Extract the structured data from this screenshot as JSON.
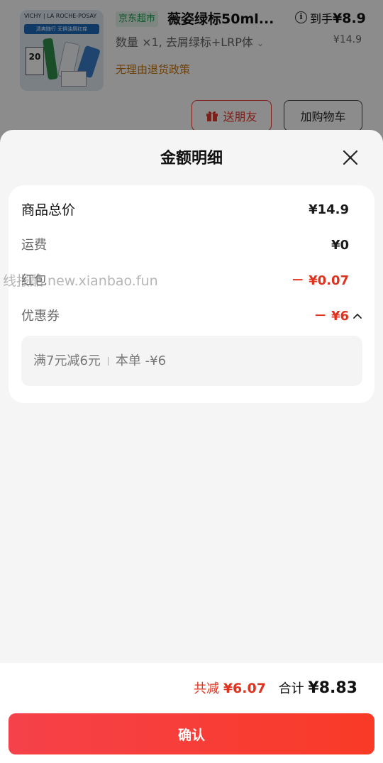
{
  "product": {
    "shop_tag": "京东超市",
    "title": "薇姿绿标50ml...",
    "price_label": "到手",
    "price": "¥8.9",
    "spec": "数量 ×1, 去屑绿标+LRP体",
    "original_price": "¥14.9",
    "return_policy": "无理由退货政策",
    "image": {
      "brand_text": "VICHY | LA ROCHE-POSAY",
      "banner_text": "清爽随行 无惧油屑红痒",
      "box_number": "20"
    },
    "gift_button": "送朋友",
    "cart_button": "加购物车"
  },
  "sheet": {
    "title": "金额明细",
    "rows": [
      {
        "label": "商品总价",
        "value": "¥14.9"
      },
      {
        "label": "运费",
        "value": "¥0"
      },
      {
        "label": "红包",
        "value": "－ ¥0.07"
      },
      {
        "label": "优惠券",
        "value": "－ ¥6"
      }
    ],
    "coupon": {
      "condition": "满7元减6元",
      "applied": "本单 -¥6"
    }
  },
  "watermark": "线报酷 new.xianbao.fun",
  "footer": {
    "total_reduce_label": "共减",
    "total_reduce_value": "¥6.07",
    "sum_label": "合计",
    "sum_value": "¥8.83",
    "confirm": "确认"
  },
  "colors": {
    "accent_red": "#e0331f",
    "green_tag": "#1d9a4d",
    "orange_policy": "#c9770f"
  }
}
